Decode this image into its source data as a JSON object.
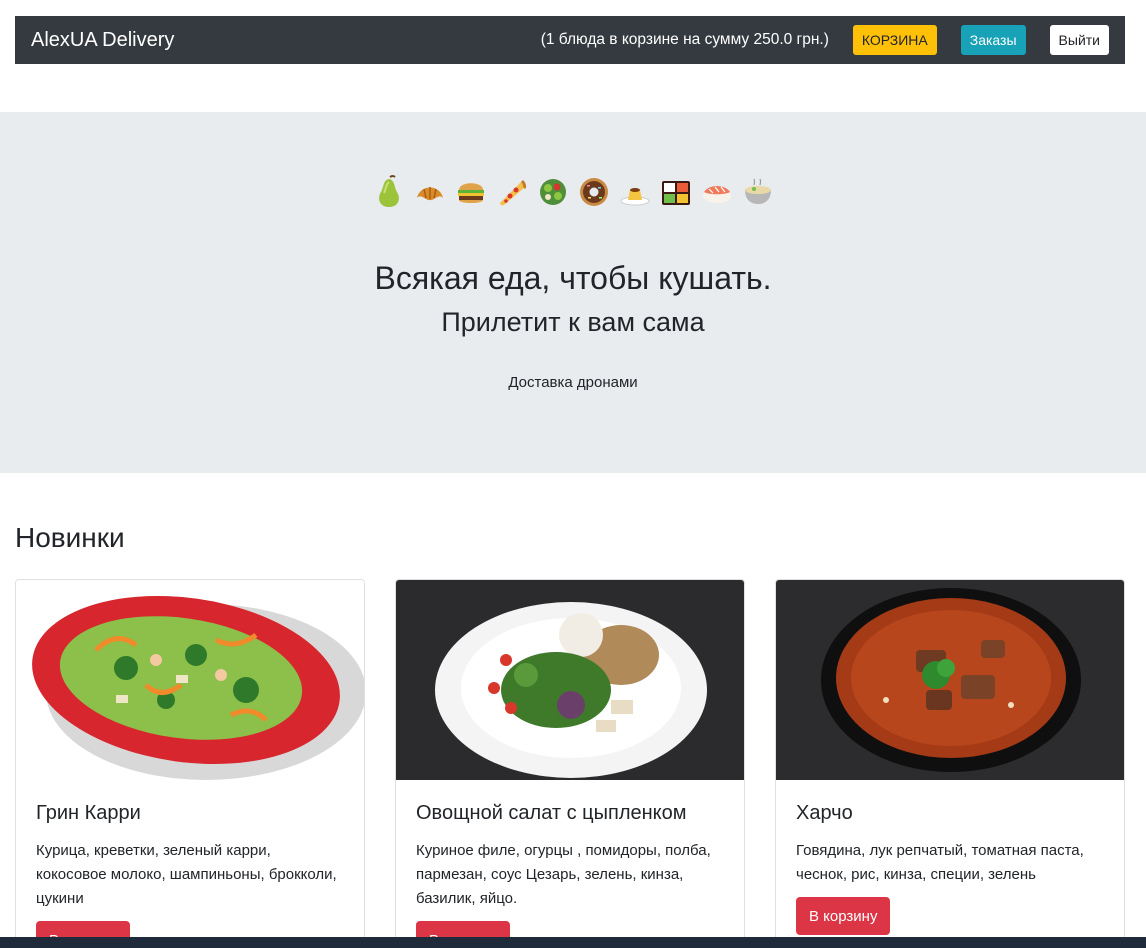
{
  "navbar": {
    "brand": "AlexUA Delivery",
    "cart_summary": "(1 блюда в корзине на сумму 250.0 грн.)",
    "cart_button": "КОРЗИНА",
    "orders_button": "Заказы",
    "logout_button": "Выйти"
  },
  "hero": {
    "emoji_icons": [
      "pear-icon",
      "croissant-icon",
      "burger-icon",
      "pizza-icon",
      "salad-icon",
      "donut-icon",
      "pudding-icon",
      "bento-icon",
      "sushi-icon",
      "soup-icon"
    ],
    "title": "Всякая еда, чтобы кушать.",
    "subtitle": "Прилетит к вам сама",
    "text": "Доставка дронами"
  },
  "new_items": {
    "title": "Новинки",
    "cards": [
      {
        "title": "Грин Карри",
        "description": "Курица, креветки, зеленый карри, кокосовое молоко, шампиньоны, брокколи, цукини",
        "button": "В корзину"
      },
      {
        "title": "Овощной салат с цыпленком",
        "description": "Куриное филе, огурцы , помидоры, полба, пармезан, соус Цезарь, зелень, кинза, базилик, яйцо.",
        "button": "В корзину"
      },
      {
        "title": "Харчо",
        "description": "Говядина, лук репчатый, томатная паста, чеснок, рис, кинза, специи, зелень",
        "button": "В корзину"
      }
    ]
  },
  "colors": {
    "navbar_bg": "#343a40",
    "cart_btn": "#ffc107",
    "orders_btn": "#17a2b8",
    "add_btn": "#dc3545",
    "hero_bg": "#e9ecef"
  }
}
